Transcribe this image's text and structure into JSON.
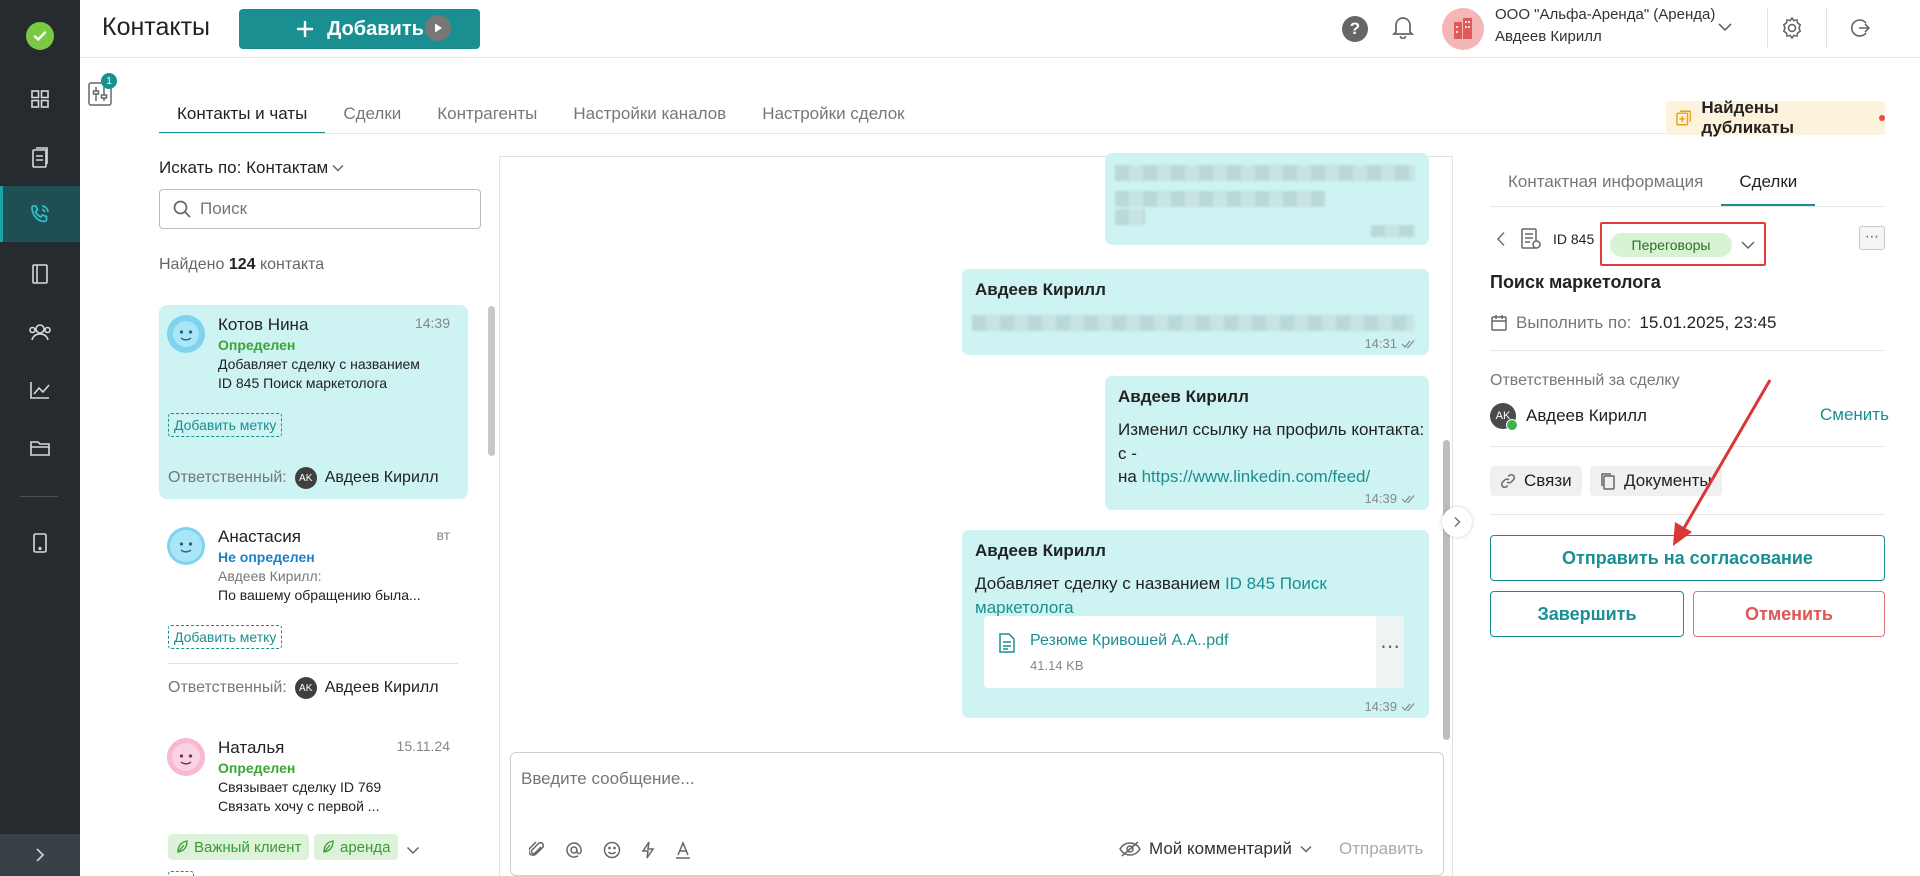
{
  "header": {
    "title": "Контакты",
    "add_label": "Добавить",
    "org_name": "ООО \"Альфа-Аренда\" (Аренда)",
    "user_name": "Авдеев Кирилл",
    "help": "?"
  },
  "filter_badge": "1",
  "tabs": [
    {
      "label": "Контакты и чаты"
    },
    {
      "label": "Сделки"
    },
    {
      "label": "Контрагенты"
    },
    {
      "label": "Настройки каналов"
    },
    {
      "label": "Настройки сделок"
    }
  ],
  "duplicates_label": "Найдены дубликаты",
  "contacts": {
    "search_by": "Искать по: Контактам",
    "search_placeholder": "Поиск",
    "found_prefix": "Найдено",
    "found_count": "124",
    "found_suffix": "контакта",
    "add_tag": "Добавить метку",
    "responsible_label": "Ответственный:",
    "items": [
      {
        "name": "Котов Нина",
        "time": "14:39",
        "status": "Определен",
        "line1": "Добавляет сделку с названием",
        "line2": "ID 845 Поиск маркетолога",
        "responsible": "Авдеев Кирилл",
        "initials": "AK"
      },
      {
        "name": "Анастасия",
        "time": "вт",
        "status": "Не определен",
        "line1": "Авдеев Кирилл:",
        "line2": "По вашему обращению была...",
        "responsible": "Авдеев Кирилл",
        "initials": "AK"
      },
      {
        "name": "Наталья",
        "time": "15.11.24",
        "status": "Определен",
        "line1": "Связывает сделку ID 769",
        "line2": "Связать хочу с первой ...",
        "tags": [
          "Важный клиент",
          "аренда"
        ]
      }
    ]
  },
  "chat": {
    "messages": [
      {
        "author": "Авдеев Кирилл",
        "time": "14:31"
      },
      {
        "author": "Авдеев Кирилл",
        "line1": "Изменил ссылку на профиль контакта:",
        "line2": "с -",
        "line3_prefix": "на",
        "link": "https://www.linkedin.com/feed/",
        "time": "14:39"
      },
      {
        "author": "Авдеев Кирилл",
        "text": "Добавляет сделку с названием",
        "link": "ID 845 Поиск маркетолога",
        "file_name": "Резюме Кривошей А.А..pdf",
        "file_size": "41.14 KB",
        "file_more": "⋯",
        "time": "14:39"
      }
    ],
    "composer_placeholder": "Введите сообщение...",
    "comment_mode": "Мой комментарий",
    "send_label": "Отправить"
  },
  "deal": {
    "tabs": [
      {
        "label": "Контактная информация"
      },
      {
        "label": "Сделки"
      }
    ],
    "id_label": "ID 845",
    "status": "Переговоры",
    "more": "⋯",
    "title": "Поиск маркетолога",
    "due_label": "Выполнить по:",
    "due_value": "15.01.2025, 23:45",
    "responsible_label": "Ответственный за сделку",
    "responsible_name": "Авдеев Кирилл",
    "responsible_initials": "AK",
    "change_label": "Сменить",
    "links_label": "Связи",
    "docs_label": "Документы",
    "submit_label": "Отправить на согласование",
    "complete_label": "Завершить",
    "cancel_label": "Отменить"
  },
  "colors": {
    "accent": "#1a8f92",
    "sidebar": "#262b30",
    "bubble": "#cdf3f2",
    "danger": "#e23b3b"
  }
}
